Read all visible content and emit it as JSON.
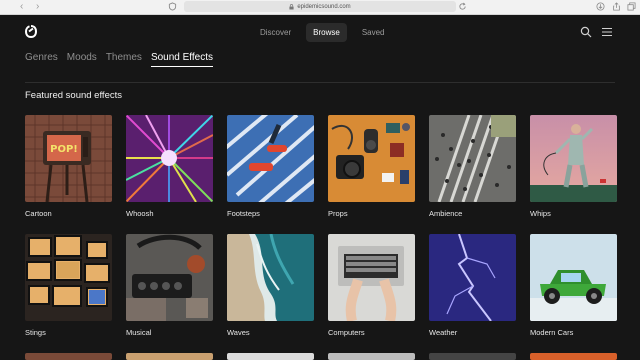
{
  "browser": {
    "url": "epidemicsound.com"
  },
  "header": {
    "nav": [
      {
        "label": "Discover",
        "active": false
      },
      {
        "label": "Browse",
        "active": true
      },
      {
        "label": "Saved",
        "active": false
      }
    ]
  },
  "category_tabs": [
    {
      "label": "Genres",
      "active": false
    },
    {
      "label": "Moods",
      "active": false
    },
    {
      "label": "Themes",
      "active": false
    },
    {
      "label": "Sound Effects",
      "active": true
    }
  ],
  "section": {
    "title": "Featured sound effects"
  },
  "tiles": [
    {
      "label": "Cartoon"
    },
    {
      "label": "Whoosh"
    },
    {
      "label": "Footsteps"
    },
    {
      "label": "Props"
    },
    {
      "label": "Ambience"
    },
    {
      "label": "Whips"
    },
    {
      "label": "Stings"
    },
    {
      "label": "Musical"
    },
    {
      "label": "Waves"
    },
    {
      "label": "Computers"
    },
    {
      "label": "Weather"
    },
    {
      "label": "Modern Cars"
    }
  ],
  "colors": {
    "background": "#161616",
    "text": "#ffffff",
    "muted": "#9c9c9c"
  }
}
